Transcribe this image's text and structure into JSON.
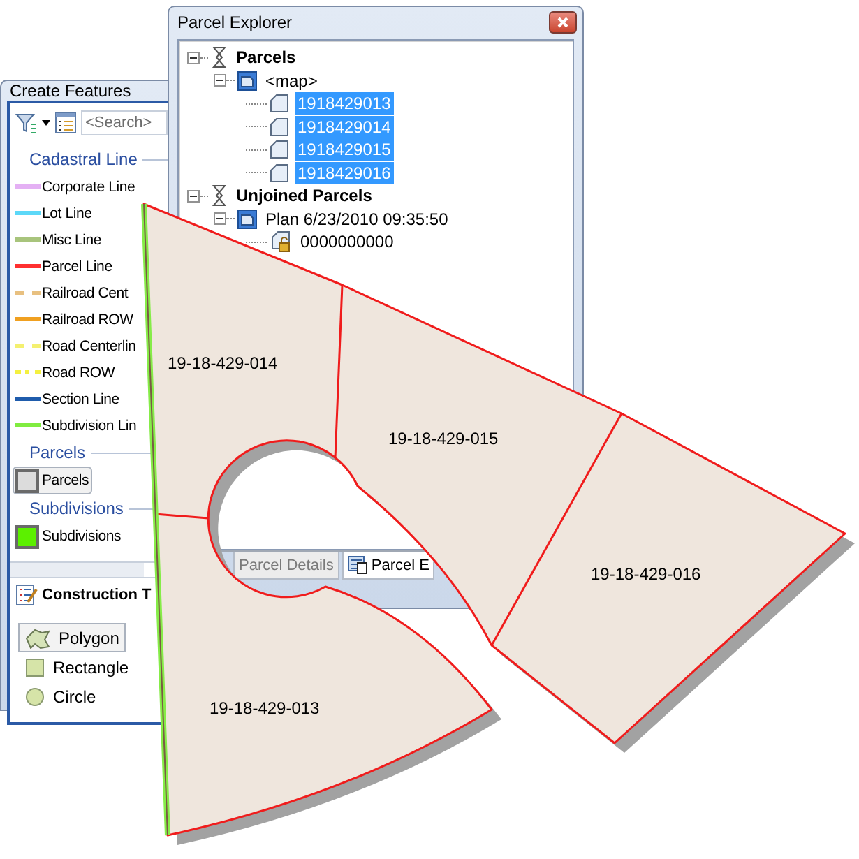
{
  "create_features": {
    "title": "Create Features",
    "search": {
      "placeholder": "<Search>"
    },
    "groups": [
      {
        "label": "Cadastral Line",
        "items": [
          {
            "label": "Corporate Line",
            "kind": "solid",
            "color": "#e4b0f4",
            "selected": false
          },
          {
            "label": "Lot Line",
            "kind": "solid",
            "color": "#5cd8f8",
            "selected": false
          },
          {
            "label": "Misc Line",
            "kind": "solid",
            "color": "#a8c47c",
            "selected": false
          },
          {
            "label": "Parcel Line",
            "kind": "solid",
            "color": "#ff3030",
            "selected": false
          },
          {
            "label": "Railroad Cent",
            "kind": "dashed",
            "color": "#e8c080",
            "selected": false
          },
          {
            "label": "Railroad ROW",
            "kind": "solid",
            "color": "#f0a020",
            "selected": false
          },
          {
            "label": "Road Centerlin",
            "kind": "dashed",
            "color": "#f4f070",
            "selected": false
          },
          {
            "label": "Road ROW",
            "kind": "dotted",
            "color": "#f4f040",
            "selected": false
          },
          {
            "label": "Section Line",
            "kind": "solid",
            "color": "#1f5cac",
            "selected": false
          },
          {
            "label": "Subdivision Lin",
            "kind": "solid",
            "color": "#80ec40",
            "selected": false
          }
        ]
      },
      {
        "label": "Parcels",
        "items": [
          {
            "label": "Parcels",
            "kind": "fill",
            "color": "#dcdcdc",
            "selected": true
          }
        ]
      },
      {
        "label": "Subdivisions",
        "items": [
          {
            "label": "Subdivisions",
            "kind": "fill",
            "color": "#5cf000",
            "selected": false
          }
        ]
      }
    ],
    "construction_tools": {
      "title": "Construction T",
      "tools": [
        {
          "label": "Polygon",
          "kind": "polygon",
          "selected": true
        },
        {
          "label": "Rectangle",
          "kind": "rectangle",
          "selected": false
        },
        {
          "label": "Circle",
          "kind": "circle",
          "selected": false
        }
      ]
    }
  },
  "parcel_explorer": {
    "title": "Parcel Explorer",
    "tree": [
      {
        "label": "Parcels",
        "kind": "fabric",
        "expanded": true,
        "selected": false,
        "children": [
          {
            "label": "<map>",
            "kind": "plan",
            "expanded": true,
            "selected": false,
            "children": [
              {
                "label": "1918429013",
                "kind": "parcel",
                "selected": true
              },
              {
                "label": "1918429014",
                "kind": "parcel",
                "selected": true
              },
              {
                "label": "1918429015",
                "kind": "parcel",
                "selected": true
              },
              {
                "label": "1918429016",
                "kind": "parcel",
                "selected": true
              }
            ]
          }
        ]
      },
      {
        "label": "Unjoined Parcels",
        "kind": "fabric",
        "expanded": true,
        "selected": false,
        "children": [
          {
            "label": "Plan 6/23/2010 09:35:50",
            "kind": "plan",
            "expanded": true,
            "selected": false,
            "children": [
              {
                "label": "0000000000",
                "kind": "locked_parcel",
                "selected": false
              }
            ]
          }
        ]
      }
    ],
    "tabs": [
      {
        "label": "Parcel Details",
        "selected": false
      },
      {
        "label": "Parcel E",
        "selected": true
      }
    ]
  },
  "map": {
    "parcels": [
      {
        "label": "19-18-429-014"
      },
      {
        "label": "19-18-429-015"
      },
      {
        "label": "19-18-429-016"
      },
      {
        "label": "19-18-429-013"
      }
    ]
  }
}
